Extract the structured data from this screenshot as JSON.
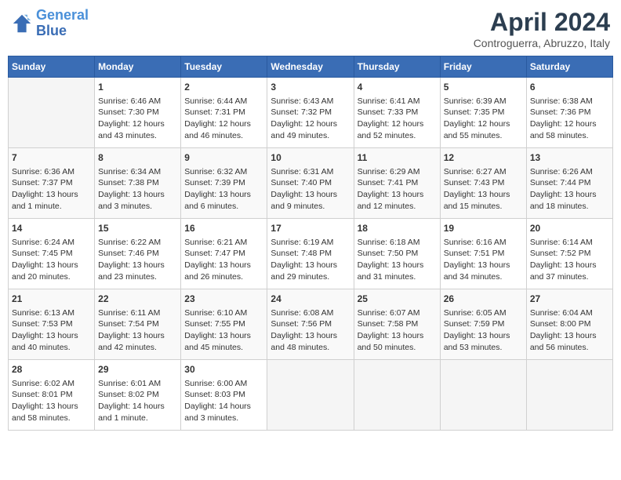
{
  "header": {
    "logo_line1": "General",
    "logo_line2": "Blue",
    "title": "April 2024",
    "location": "Controguerra, Abruzzo, Italy"
  },
  "calendar": {
    "days_of_week": [
      "Sunday",
      "Monday",
      "Tuesday",
      "Wednesday",
      "Thursday",
      "Friday",
      "Saturday"
    ],
    "weeks": [
      [
        {
          "num": "",
          "content": ""
        },
        {
          "num": "1",
          "content": "Sunrise: 6:46 AM\nSunset: 7:30 PM\nDaylight: 12 hours\nand 43 minutes."
        },
        {
          "num": "2",
          "content": "Sunrise: 6:44 AM\nSunset: 7:31 PM\nDaylight: 12 hours\nand 46 minutes."
        },
        {
          "num": "3",
          "content": "Sunrise: 6:43 AM\nSunset: 7:32 PM\nDaylight: 12 hours\nand 49 minutes."
        },
        {
          "num": "4",
          "content": "Sunrise: 6:41 AM\nSunset: 7:33 PM\nDaylight: 12 hours\nand 52 minutes."
        },
        {
          "num": "5",
          "content": "Sunrise: 6:39 AM\nSunset: 7:35 PM\nDaylight: 12 hours\nand 55 minutes."
        },
        {
          "num": "6",
          "content": "Sunrise: 6:38 AM\nSunset: 7:36 PM\nDaylight: 12 hours\nand 58 minutes."
        }
      ],
      [
        {
          "num": "7",
          "content": "Sunrise: 6:36 AM\nSunset: 7:37 PM\nDaylight: 13 hours\nand 1 minute."
        },
        {
          "num": "8",
          "content": "Sunrise: 6:34 AM\nSunset: 7:38 PM\nDaylight: 13 hours\nand 3 minutes."
        },
        {
          "num": "9",
          "content": "Sunrise: 6:32 AM\nSunset: 7:39 PM\nDaylight: 13 hours\nand 6 minutes."
        },
        {
          "num": "10",
          "content": "Sunrise: 6:31 AM\nSunset: 7:40 PM\nDaylight: 13 hours\nand 9 minutes."
        },
        {
          "num": "11",
          "content": "Sunrise: 6:29 AM\nSunset: 7:41 PM\nDaylight: 13 hours\nand 12 minutes."
        },
        {
          "num": "12",
          "content": "Sunrise: 6:27 AM\nSunset: 7:43 PM\nDaylight: 13 hours\nand 15 minutes."
        },
        {
          "num": "13",
          "content": "Sunrise: 6:26 AM\nSunset: 7:44 PM\nDaylight: 13 hours\nand 18 minutes."
        }
      ],
      [
        {
          "num": "14",
          "content": "Sunrise: 6:24 AM\nSunset: 7:45 PM\nDaylight: 13 hours\nand 20 minutes."
        },
        {
          "num": "15",
          "content": "Sunrise: 6:22 AM\nSunset: 7:46 PM\nDaylight: 13 hours\nand 23 minutes."
        },
        {
          "num": "16",
          "content": "Sunrise: 6:21 AM\nSunset: 7:47 PM\nDaylight: 13 hours\nand 26 minutes."
        },
        {
          "num": "17",
          "content": "Sunrise: 6:19 AM\nSunset: 7:48 PM\nDaylight: 13 hours\nand 29 minutes."
        },
        {
          "num": "18",
          "content": "Sunrise: 6:18 AM\nSunset: 7:50 PM\nDaylight: 13 hours\nand 31 minutes."
        },
        {
          "num": "19",
          "content": "Sunrise: 6:16 AM\nSunset: 7:51 PM\nDaylight: 13 hours\nand 34 minutes."
        },
        {
          "num": "20",
          "content": "Sunrise: 6:14 AM\nSunset: 7:52 PM\nDaylight: 13 hours\nand 37 minutes."
        }
      ],
      [
        {
          "num": "21",
          "content": "Sunrise: 6:13 AM\nSunset: 7:53 PM\nDaylight: 13 hours\nand 40 minutes."
        },
        {
          "num": "22",
          "content": "Sunrise: 6:11 AM\nSunset: 7:54 PM\nDaylight: 13 hours\nand 42 minutes."
        },
        {
          "num": "23",
          "content": "Sunrise: 6:10 AM\nSunset: 7:55 PM\nDaylight: 13 hours\nand 45 minutes."
        },
        {
          "num": "24",
          "content": "Sunrise: 6:08 AM\nSunset: 7:56 PM\nDaylight: 13 hours\nand 48 minutes."
        },
        {
          "num": "25",
          "content": "Sunrise: 6:07 AM\nSunset: 7:58 PM\nDaylight: 13 hours\nand 50 minutes."
        },
        {
          "num": "26",
          "content": "Sunrise: 6:05 AM\nSunset: 7:59 PM\nDaylight: 13 hours\nand 53 minutes."
        },
        {
          "num": "27",
          "content": "Sunrise: 6:04 AM\nSunset: 8:00 PM\nDaylight: 13 hours\nand 56 minutes."
        }
      ],
      [
        {
          "num": "28",
          "content": "Sunrise: 6:02 AM\nSunset: 8:01 PM\nDaylight: 13 hours\nand 58 minutes."
        },
        {
          "num": "29",
          "content": "Sunrise: 6:01 AM\nSunset: 8:02 PM\nDaylight: 14 hours\nand 1 minute."
        },
        {
          "num": "30",
          "content": "Sunrise: 6:00 AM\nSunset: 8:03 PM\nDaylight: 14 hours\nand 3 minutes."
        },
        {
          "num": "",
          "content": ""
        },
        {
          "num": "",
          "content": ""
        },
        {
          "num": "",
          "content": ""
        },
        {
          "num": "",
          "content": ""
        }
      ]
    ]
  }
}
